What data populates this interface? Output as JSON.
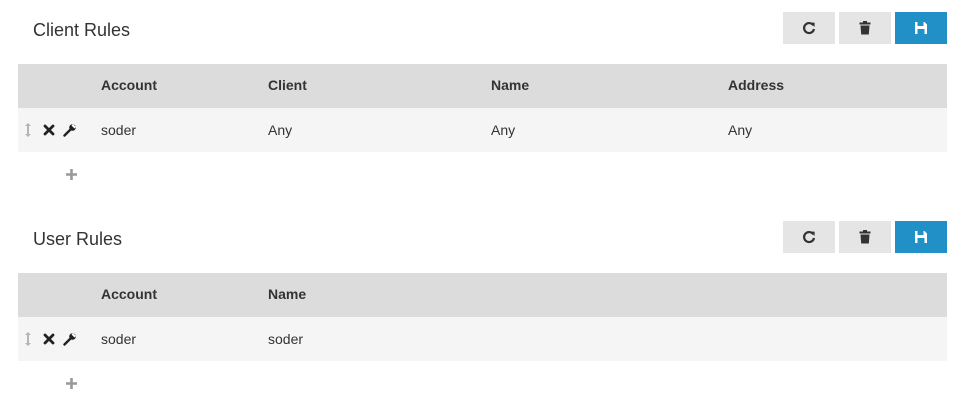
{
  "client_rules": {
    "title": "Client Rules",
    "toolbar": {
      "refresh_icon": "refresh-icon",
      "delete_icon": "trash-icon",
      "save_icon": "save-icon",
      "save_color": "#2190c6"
    },
    "columns": [
      "Account",
      "Client",
      "Name",
      "Address"
    ],
    "rows": [
      {
        "account": "soder",
        "client": "Any",
        "name": "Any",
        "address": "Any"
      }
    ]
  },
  "user_rules": {
    "title": "User Rules",
    "toolbar": {
      "refresh_icon": "refresh-icon",
      "delete_icon": "trash-icon",
      "save_icon": "save-icon",
      "save_color": "#2190c6"
    },
    "columns": [
      "Account",
      "Name"
    ],
    "rows": [
      {
        "account": "soder",
        "name": "soder"
      }
    ]
  }
}
